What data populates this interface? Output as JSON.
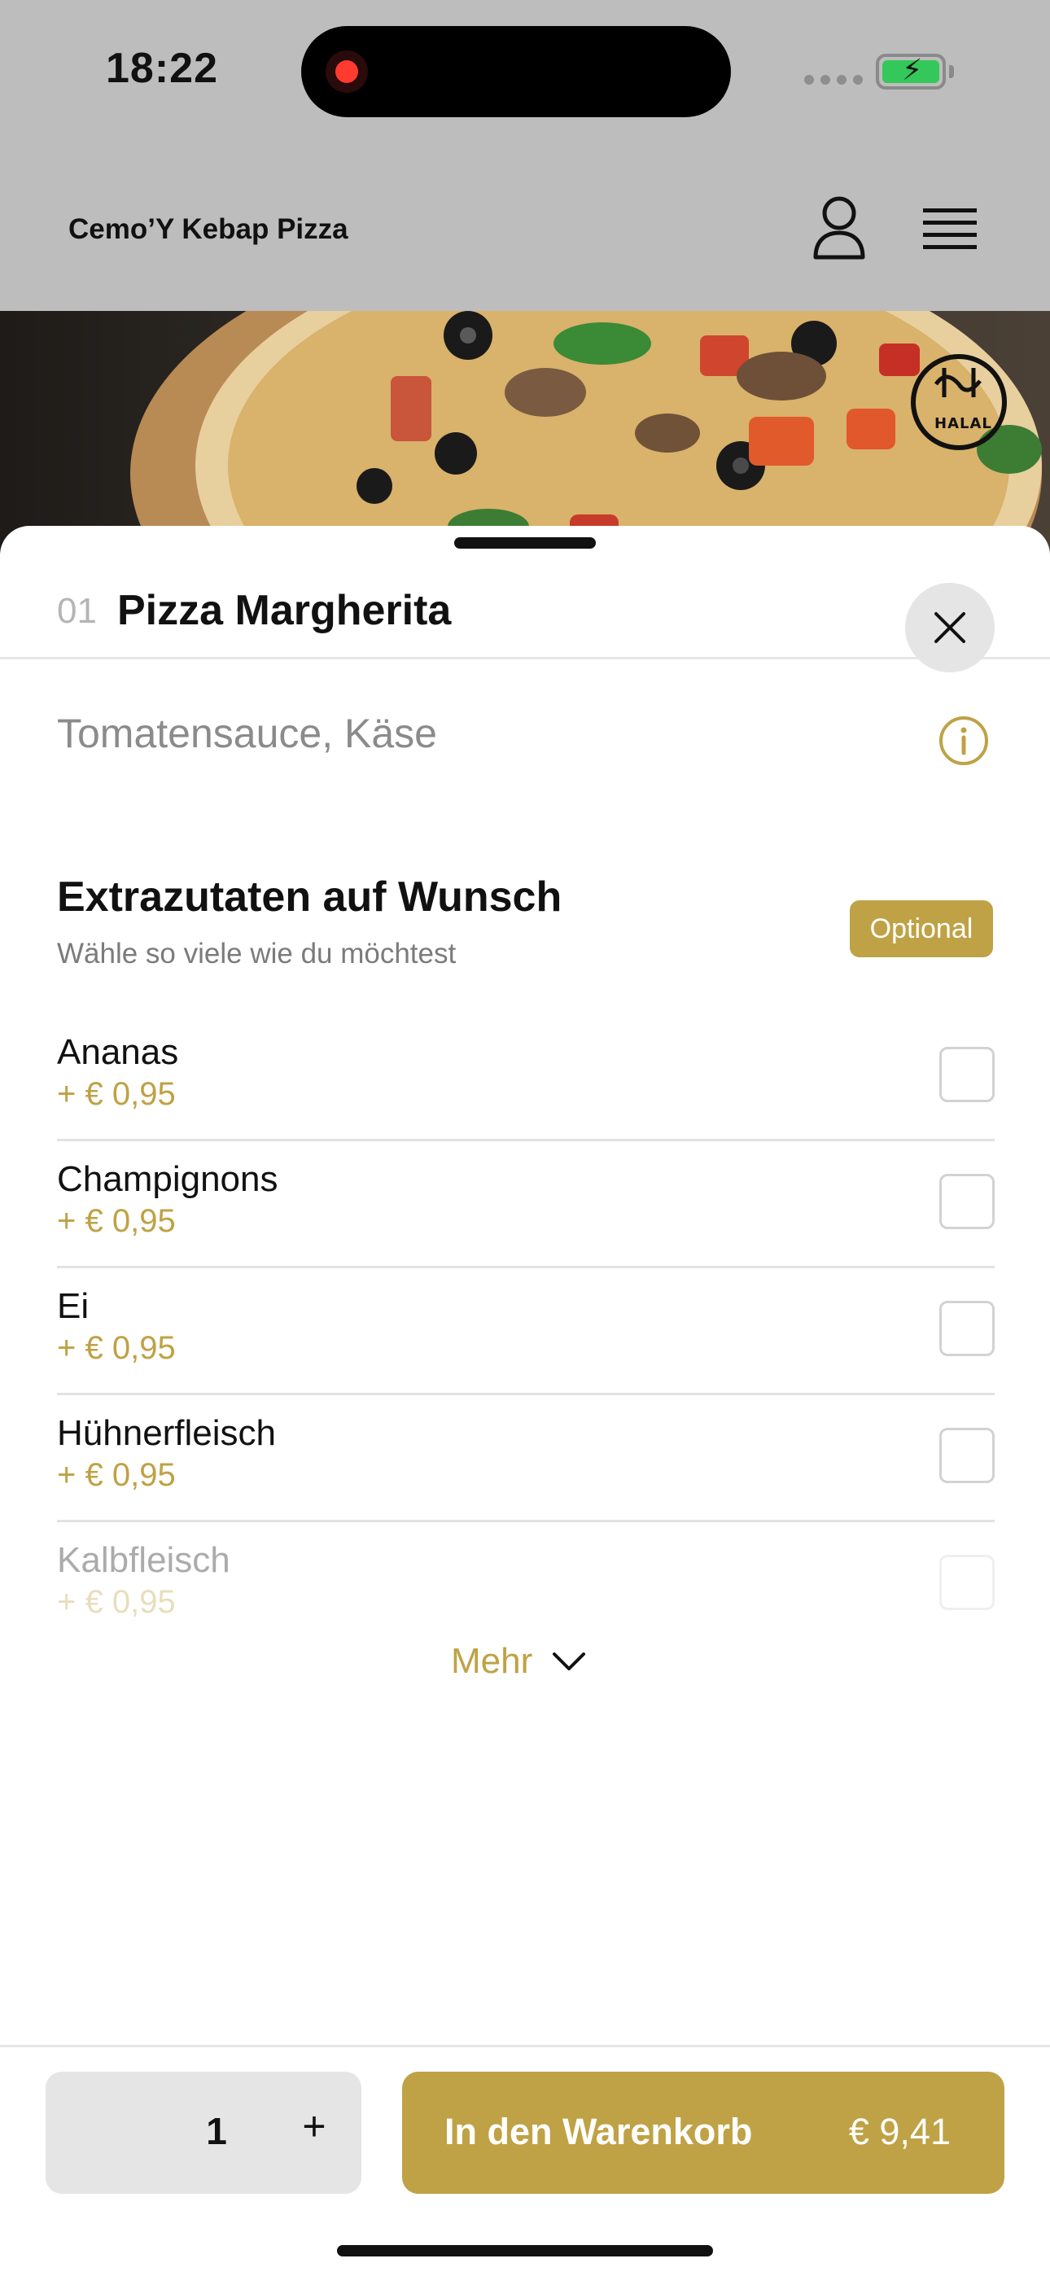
{
  "status_bar": {
    "time": "18:22"
  },
  "header": {
    "brand": "Cemo’Y Kebap Pizza",
    "halal_label": "HALAL"
  },
  "item": {
    "number": "01",
    "name": "Pizza Margherita",
    "description": "Tomatensauce, Käse"
  },
  "extras": {
    "title": "Extrazutaten auf Wunsch",
    "subtitle": "Wähle so viele wie du möchtest",
    "badge": "Optional",
    "options": [
      {
        "name": "Ananas",
        "price": "+ € 0,95"
      },
      {
        "name": "Champignons",
        "price": "+ € 0,95"
      },
      {
        "name": "Ei",
        "price": "+ € 0,95"
      },
      {
        "name": "Hühnerfleisch",
        "price": "+ € 0,95"
      },
      {
        "name": "Kalbfleisch",
        "price": "+ € 0,95"
      }
    ],
    "more_label": "Mehr"
  },
  "footer": {
    "quantity": "1",
    "plus_label": "+",
    "cart_label": "In den Warenkorb",
    "cart_price": "€ 9,41"
  },
  "colors": {
    "accent": "#bfa245",
    "backdrop": "#bdbdbd"
  }
}
